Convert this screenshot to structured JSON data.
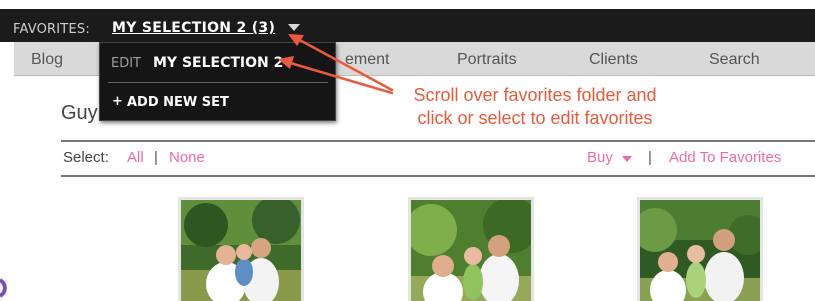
{
  "favorites_bar": {
    "label": "FAVORITES:",
    "current_set": "MY SELECTION 2 (3)"
  },
  "nav": {
    "items": [
      "Blog",
      "ement",
      "Portraits",
      "Clients",
      "Search"
    ]
  },
  "dropdown": {
    "edit_prefix": "EDIT",
    "edit_name": "MY SELECTION 2",
    "add_new_icon": "+",
    "add_new_label": "ADD NEW SET"
  },
  "gallery": {
    "title": "Guy"
  },
  "selection_bar": {
    "select_label": "Select:",
    "all": "All",
    "divider": "|",
    "none": "None",
    "buy": "Buy",
    "add_to_favorites": "Add To Favorites"
  },
  "annotation": {
    "line1": "Scroll over favorites folder and",
    "line2": "click or select to edit favorites"
  },
  "thumbnails": [
    "family-photo-1",
    "family-photo-2",
    "family-photo-3"
  ],
  "colors": {
    "favorites_bar_bg": "#1b1b1b",
    "nav_bg": "#d9d9d9",
    "link_pink": "#ee6aa7",
    "annotation_red": "#ea5a3c"
  }
}
